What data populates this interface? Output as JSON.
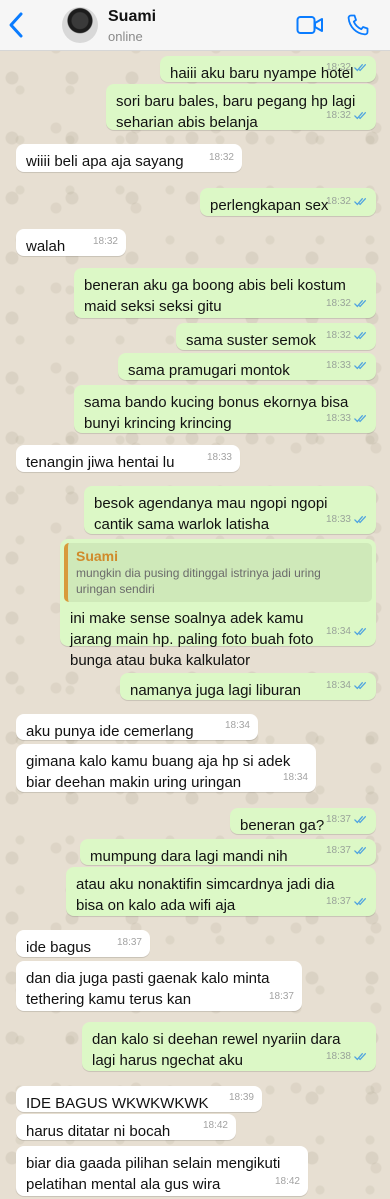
{
  "header": {
    "contact_name": "Suami",
    "status": "online"
  },
  "colors": {
    "accent": "#0a7cff",
    "outgoing_bubble": "#dcf8c6",
    "incoming_bubble": "#ffffff",
    "read_ticks": "#4fa3e0",
    "quote_bar": "#d89b3b"
  },
  "messages": [
    {
      "dir": "out",
      "text": "haiii aku baru nyampe hotel",
      "time": "18:32"
    },
    {
      "dir": "out",
      "text": "sori baru bales, baru pegang hp lagi\nseharian abis belanja",
      "time": "18:32"
    },
    {
      "dir": "in",
      "text": "wiiii beli apa aja sayang",
      "time": "18:32"
    },
    {
      "dir": "out",
      "text": "perlengkapan sex",
      "time": "18:32"
    },
    {
      "dir": "in",
      "text": "walah",
      "time": "18:32"
    },
    {
      "dir": "out",
      "text": "beneran aku ga boong abis beli kostum\nmaid seksi seksi gitu",
      "time": "18:32"
    },
    {
      "dir": "out",
      "text": "sama suster semok",
      "time": "18:32"
    },
    {
      "dir": "out",
      "text": "sama pramugari montok",
      "time": "18:33"
    },
    {
      "dir": "out",
      "text": "sama bando kucing bonus ekornya bisa\nbunyi krincing krincing",
      "time": "18:33"
    },
    {
      "dir": "in",
      "text": "tenangin jiwa hentai lu",
      "time": "18:33"
    },
    {
      "dir": "out",
      "text": "besok agendanya mau ngopi ngopi\ncantik sama warlok latisha",
      "time": "18:33"
    },
    {
      "dir": "out",
      "quote_name": "Suami",
      "quote_text": "mungkin dia pusing ditinggal istrinya jadi uring\nuringan sendiri",
      "text": "ini make sense soalnya adek kamu\njarang main hp. paling foto buah foto\nbunga atau buka kalkulator",
      "time": "18:34"
    },
    {
      "dir": "out",
      "text": "namanya juga lagi liburan",
      "time": "18:34"
    },
    {
      "dir": "in",
      "text": "aku punya ide cemerlang",
      "time": "18:34"
    },
    {
      "dir": "in",
      "text": "gimana kalo kamu buang aja hp si adek\nbiar deehan makin uring uringan",
      "time": "18:34"
    },
    {
      "dir": "out",
      "text": "beneran ga?",
      "time": "18:37"
    },
    {
      "dir": "out",
      "text": "mumpung dara lagi mandi nih",
      "time": "18:37"
    },
    {
      "dir": "out",
      "text": "atau aku nonaktifin simcardnya jadi dia\nbisa on kalo ada wifi aja",
      "time": "18:37"
    },
    {
      "dir": "in",
      "text": "ide bagus",
      "time": "18:37"
    },
    {
      "dir": "in",
      "text": "dan dia juga pasti gaenak kalo minta\ntethering kamu terus kan",
      "time": "18:37"
    },
    {
      "dir": "out",
      "text": "dan kalo si deehan rewel nyariin dara\nlagi harus ngechat aku",
      "time": "18:38"
    },
    {
      "dir": "in",
      "text": "IDE BAGUS WKWKWKWK",
      "time": "18:39"
    },
    {
      "dir": "in",
      "text": "harus ditatar ni bocah",
      "time": "18:42"
    },
    {
      "dir": "in",
      "text": "biar dia gaada pilihan selain mengikuti\npelatihan mental ala gus wira",
      "time": "18:42"
    }
  ]
}
